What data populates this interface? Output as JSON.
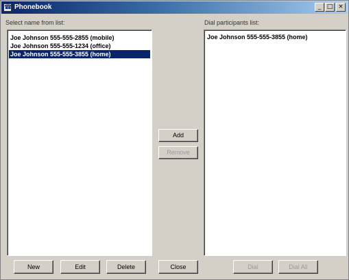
{
  "window": {
    "title": "Phonebook",
    "minimize_glyph": "_",
    "maximize_glyph": "□",
    "close_glyph": "×"
  },
  "left_panel": {
    "label": "Select name from list:",
    "items": [
      "Joe Johnson  555-555-2855  (mobile)",
      "Joe Johnson  555-555-1234 (office)",
      "Joe Johnson 555-555-3855 (home)"
    ],
    "selected_index": 2
  },
  "right_panel": {
    "label": "Dial participants list:",
    "items": [
      "Joe Johnson 555-555-3855 (home)"
    ]
  },
  "middle_buttons": {
    "add": "Add",
    "remove": "Remove"
  },
  "bottom_buttons": {
    "new": "New",
    "edit": "Edit",
    "delete": "Delete",
    "close": "Close",
    "dial": "Dial",
    "dial_all": "Dial All"
  },
  "icons": {
    "app_icon": "phonebook-icon"
  }
}
